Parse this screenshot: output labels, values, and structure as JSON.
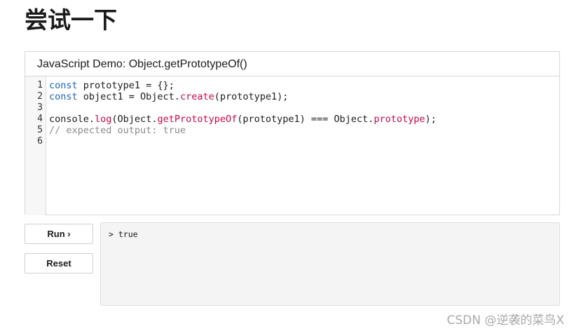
{
  "page": {
    "title": "尝试一下",
    "watermark": "CSDN @逆袭的菜鸟X"
  },
  "editor": {
    "header": "JavaScript Demo: Object.getPrototypeOf()",
    "line_numbers": [
      "1",
      "2",
      "3",
      "4",
      "5",
      "6"
    ],
    "lines": [
      [
        {
          "t": "const",
          "c": "kw"
        },
        {
          "t": " prototype1 = {};",
          "c": ""
        }
      ],
      [
        {
          "t": "const",
          "c": "kw"
        },
        {
          "t": " object1 = Object.",
          "c": ""
        },
        {
          "t": "create",
          "c": "fn"
        },
        {
          "t": "(prototype1);",
          "c": ""
        }
      ],
      [],
      [
        {
          "t": "console.",
          "c": ""
        },
        {
          "t": "log",
          "c": "fn"
        },
        {
          "t": "(Object.",
          "c": ""
        },
        {
          "t": "getPrototypeOf",
          "c": "fn"
        },
        {
          "t": "(prototype1) === Object.",
          "c": ""
        },
        {
          "t": "prototype",
          "c": "fn"
        },
        {
          "t": ");",
          "c": ""
        }
      ],
      [
        {
          "t": "// expected output: true",
          "c": "cm"
        }
      ],
      []
    ],
    "colors": {
      "keyword": "#1a63b8",
      "function": "#c8064a",
      "comment": "#8c8c8c"
    }
  },
  "controls": {
    "run_label": "Run ›",
    "reset_label": "Reset"
  },
  "output": {
    "lines": [
      "> true"
    ]
  }
}
